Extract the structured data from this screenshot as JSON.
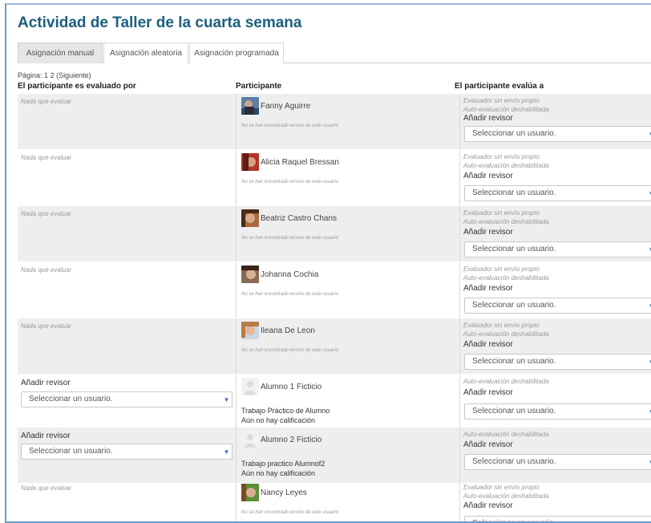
{
  "page": {
    "title": "Actividad de Taller de la cuarta semana",
    "pagination_label": "Página:",
    "pages": [
      "1",
      "2"
    ],
    "next_label": "(Siguiente)"
  },
  "tabs": [
    {
      "label": "Asignación manual",
      "active": true
    },
    {
      "label": "Asignación aleatoria",
      "active": false
    },
    {
      "label": "Asignación programada",
      "active": false
    }
  ],
  "columns": {
    "evaluated_by": "El participante es evaluado por",
    "participant": "Participante",
    "evaluates": "El participante evalúa a"
  },
  "common": {
    "nothing_to_evaluate": "Nada que evaluar",
    "add_reviewer": "Añadir revisor",
    "select_user": "Seleccionar un usuario.",
    "no_submissions": "No se han encontrado envíos de este usuario",
    "reviewer_no_submission": "Evaluador sin envío propio",
    "self_eval_disabled": "Auto-evaluación deshabilitada",
    "no_grade": "Aún no hay calificación"
  },
  "rows": [
    {
      "name": "Fanny Aguirre"
    },
    {
      "name": "Alicia Raquel Bressan"
    },
    {
      "name": "Beatriz Castro Chans"
    },
    {
      "name": "Johanna Cochia"
    },
    {
      "name": "Ileana De Leon"
    },
    {
      "name": "Alumno 1 Ficticio",
      "submission": "Trabajo Práctico de Alumno"
    },
    {
      "name": "Alumno 2 Ficticio",
      "submission": "Trabajo practico Alumnof2"
    },
    {
      "name": "Nancy Leyes"
    }
  ],
  "colors": {
    "title": "#1c5f7c",
    "frame_border": "#6b9ccc",
    "row_shade": "#eeeeee",
    "select_arrow": "#3e6fb0"
  },
  "icons": {
    "select_arrow": "chevron-down-icon",
    "avatar": "user-photo",
    "default_avatar": "default-user-icon"
  }
}
